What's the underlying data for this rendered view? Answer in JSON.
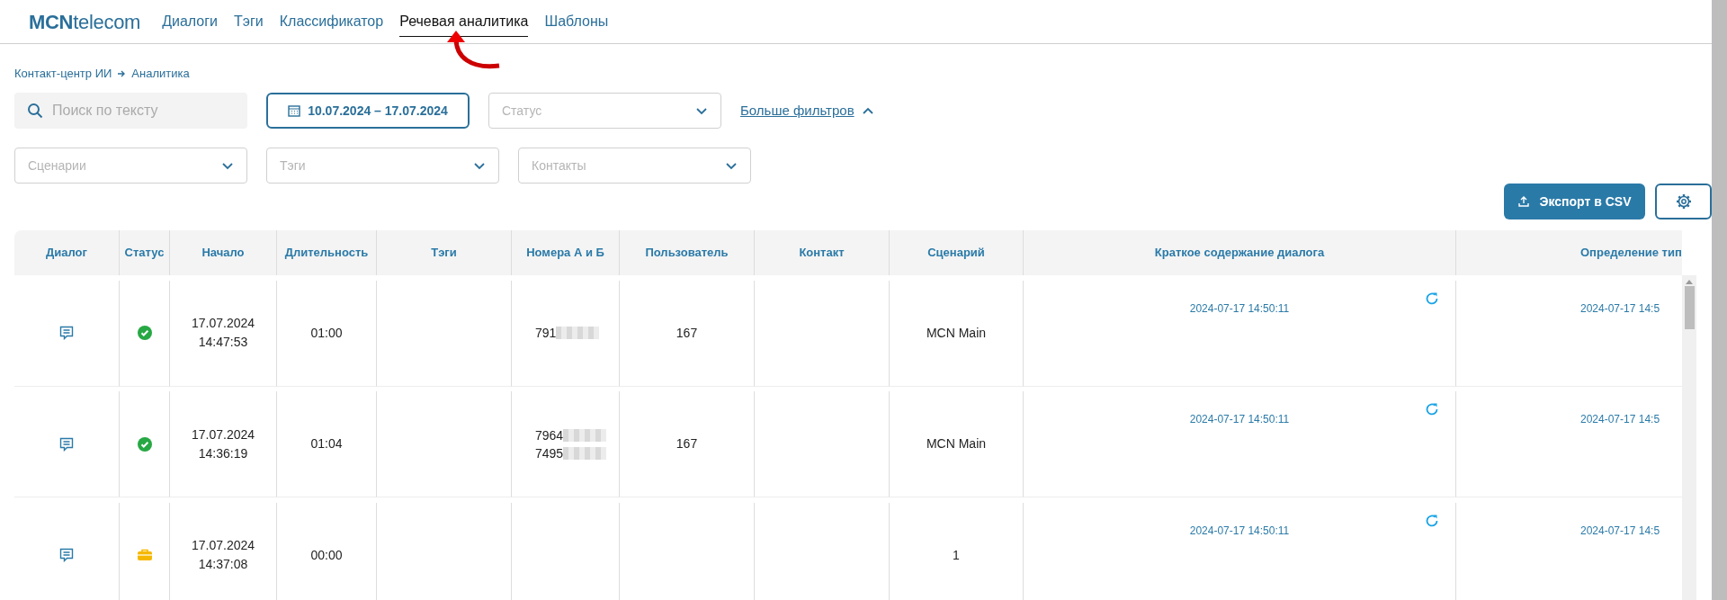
{
  "logo": {
    "bold": "MCN",
    "rest": "telecom"
  },
  "nav": [
    {
      "label": "Диалоги",
      "selected": false
    },
    {
      "label": "Тэги",
      "selected": false
    },
    {
      "label": "Классификатор",
      "selected": false
    },
    {
      "label": "Речевая аналитика",
      "selected": true
    },
    {
      "label": "Шаблоны",
      "selected": false
    }
  ],
  "breadcrumb": [
    "Контакт-центр ИИ",
    "Аналитика"
  ],
  "filters": {
    "search": {
      "placeholder": "Поиск по тексту"
    },
    "date_range": "10.07.2024 – 17.07.2024",
    "status": {
      "placeholder": "Статус"
    },
    "more_filters": {
      "label": "Больше фильтров",
      "expanded": true
    },
    "selects": [
      {
        "placeholder": "Сценарии"
      },
      {
        "placeholder": "Тэги"
      },
      {
        "placeholder": "Контакты"
      }
    ]
  },
  "actions": {
    "export": "Экспорт в CSV"
  },
  "table": {
    "columns": [
      "Диалог",
      "Статус",
      "Начало",
      "Длительность",
      "Тэги",
      "Номера А и Б",
      "Пользователь",
      "Контакт",
      "Сценарий",
      "Краткое содержание диалога",
      "Определение тип"
    ],
    "rows": [
      {
        "completed": true,
        "date": "17.07.2024",
        "time": "14:47:53",
        "duration": "01:00",
        "numbers": [
          "791"
        ],
        "user": "167",
        "scenario": "MCN Main",
        "summary_time": "2024-07-17 14:50:11",
        "type_time": "2024-07-17 14:5"
      },
      {
        "completed": true,
        "date": "17.07.2024",
        "time": "14:36:19",
        "duration": "01:04",
        "numbers": [
          "7964",
          "7495"
        ],
        "user": "167",
        "scenario": "MCN Main",
        "summary_time": "2024-07-17 14:50:11",
        "type_time": "2024-07-17 14:5"
      },
      {
        "completed": false,
        "date": "17.07.2024",
        "time": "14:37:08",
        "duration": "00:00",
        "numbers": [],
        "user": "",
        "scenario": "1",
        "summary_time": "2024-07-17 14:50:11",
        "type_time": "2024-07-17 14:5"
      }
    ]
  }
}
